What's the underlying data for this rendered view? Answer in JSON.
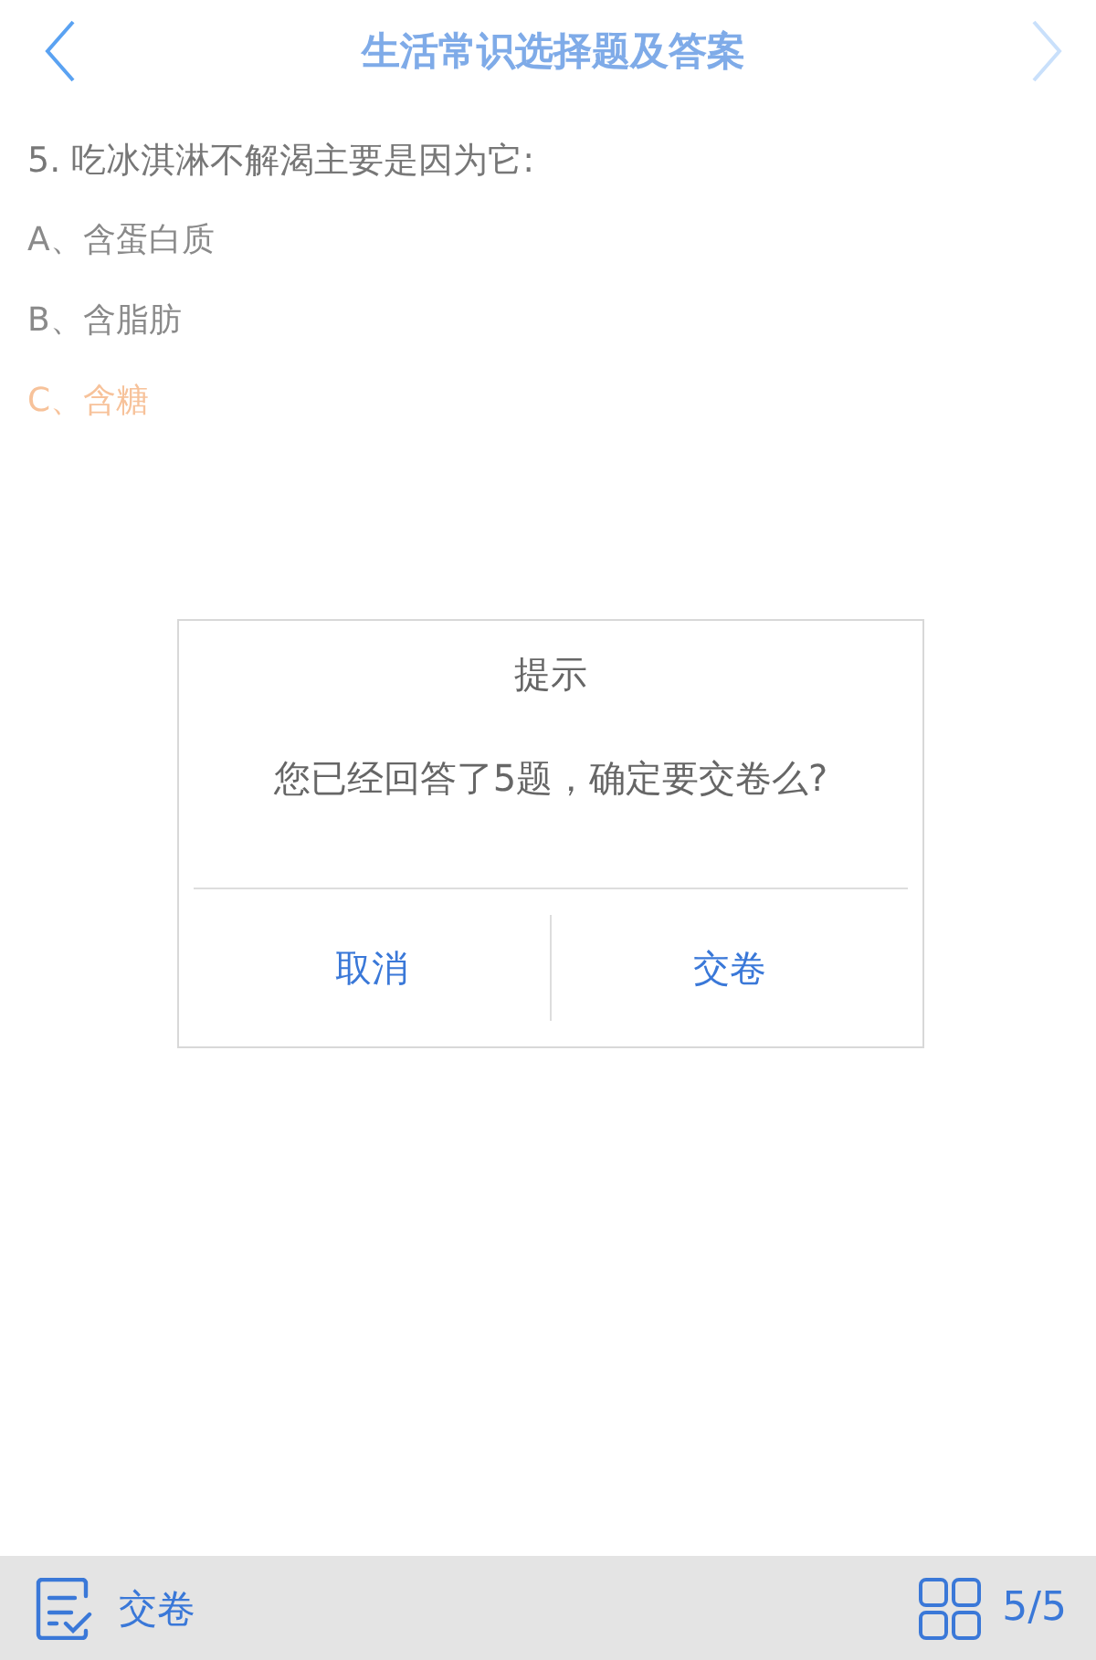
{
  "header": {
    "title": "生活常识选择题及答案",
    "prev_disabled": false,
    "next_disabled": true
  },
  "question": {
    "text": "5. 吃冰淇淋不解渴主要是因为它:",
    "options": [
      {
        "label": "A、含蛋白质",
        "selected": false
      },
      {
        "label": "B、含脂肪",
        "selected": false
      },
      {
        "label": "C、含糖",
        "selected": true
      }
    ]
  },
  "dialog": {
    "title": "提示",
    "message": "您已经回答了5题，确定要交卷么?",
    "buttons": [
      "取消",
      "交卷"
    ]
  },
  "bottom_bar": {
    "submit_label": "交卷",
    "progress": "5/5"
  }
}
